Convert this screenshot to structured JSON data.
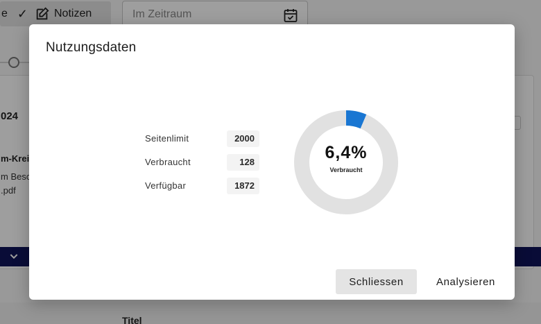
{
  "toolbar": {
    "partial_label": "e",
    "notes_label": "Notizen",
    "date_placeholder": "Im Zeitraum"
  },
  "background_card": {
    "year_fragment": "024",
    "kreis_fragment": "m-Krei",
    "besc_fragment": "m Besc",
    "pdf_fragment": ".pdf"
  },
  "lower": {
    "title_label": "Titel"
  },
  "modal": {
    "title": "Nutzungsdaten",
    "stats": [
      {
        "label": "Seitenlimit",
        "value": "2000"
      },
      {
        "label": "Verbraucht",
        "value": "128"
      },
      {
        "label": "Verfügbar",
        "value": "1872"
      }
    ],
    "chart_data": {
      "type": "pie",
      "style": "donut",
      "categories": [
        "Verbraucht",
        "Verfügbar"
      ],
      "values": [
        128,
        1872
      ],
      "center_value": "6,4%",
      "center_caption": "Verbraucht",
      "colors": {
        "used": "#1976d2",
        "remaining": "#e1e1e1"
      }
    },
    "buttons": {
      "close_label": "Schliessen",
      "analyze_label": "Analysieren"
    }
  },
  "icons": {
    "check": "check-icon",
    "edit": "edit-note-icon",
    "calendar": "calendar-icon",
    "chevron": "chevron-down-icon"
  }
}
